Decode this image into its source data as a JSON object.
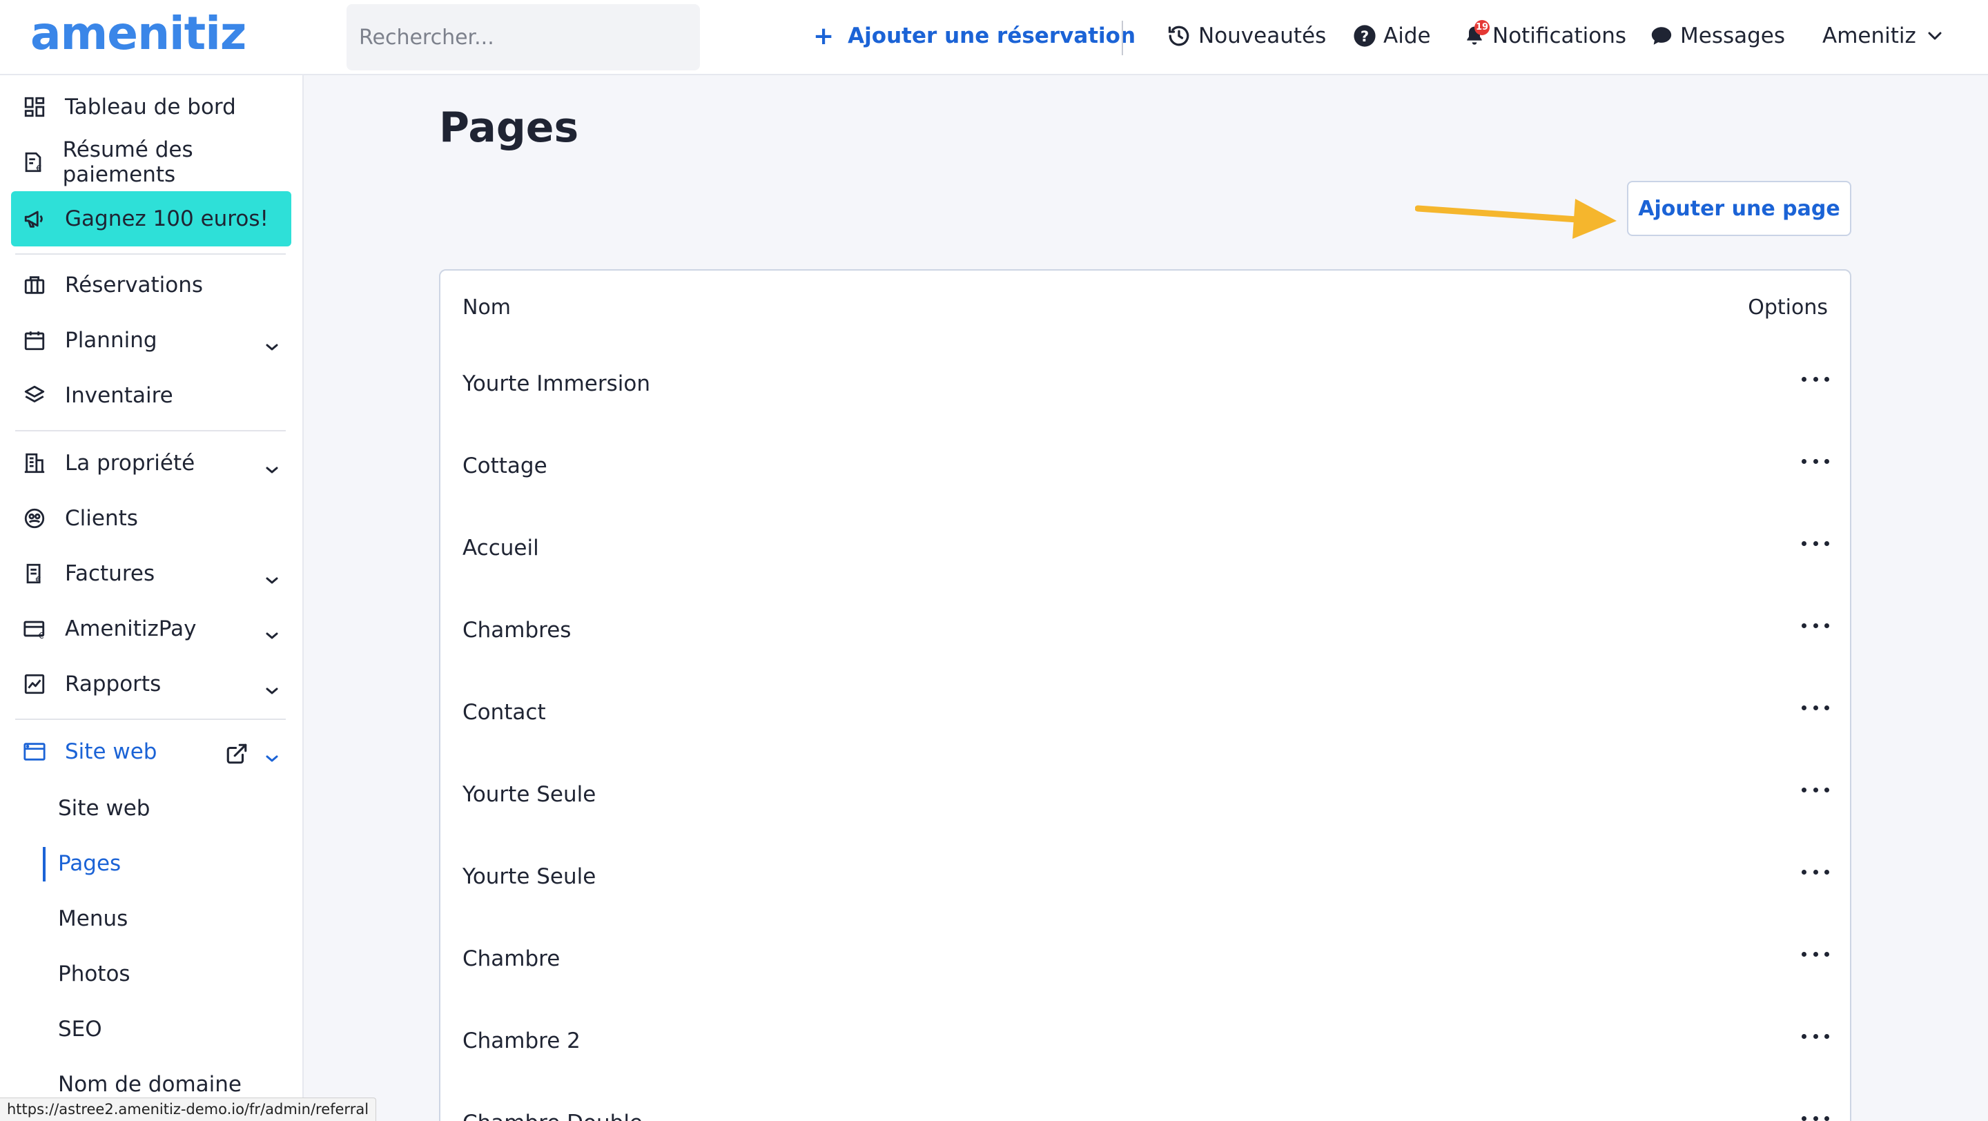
{
  "header": {
    "logo": "amenitiz",
    "search_placeholder": "Rechercher...",
    "add_reservation": "Ajouter une réservation",
    "nouveautes": "Nouveautés",
    "aide": "Aide",
    "notifications": "Notifications",
    "notification_count": "19",
    "messages": "Messages",
    "account": "Amenitiz"
  },
  "sidebar": {
    "items": [
      {
        "label": "Tableau de bord",
        "icon": "dashboard-icon"
      },
      {
        "label": "Résumé des paiements",
        "icon": "payment-summary-icon"
      },
      {
        "label": "Gagnez 100 euros!",
        "icon": "megaphone-icon"
      },
      {
        "label": "Réservations",
        "icon": "briefcase-icon"
      },
      {
        "label": "Planning",
        "icon": "calendar-icon"
      },
      {
        "label": "Inventaire",
        "icon": "layers-icon"
      },
      {
        "label": "La propriété",
        "icon": "building-icon"
      },
      {
        "label": "Clients",
        "icon": "clients-icon"
      },
      {
        "label": "Factures",
        "icon": "invoice-icon"
      },
      {
        "label": "AmenitizPay",
        "icon": "card-icon"
      },
      {
        "label": "Rapports",
        "icon": "chart-icon"
      },
      {
        "label": "Site web",
        "icon": "browser-icon"
      }
    ],
    "website_sub": [
      "Site web",
      "Pages",
      "Menus",
      "Photos",
      "SEO",
      "Nom de domaine"
    ],
    "active_sub": "Pages",
    "accent_color": "#1b63d6",
    "promo_color": "#2ee0d8"
  },
  "main": {
    "title": "Pages",
    "add_page_button": "Ajouter une page",
    "arrow_color": "#f5b62d",
    "table": {
      "col_name": "Nom",
      "col_options": "Options",
      "rows": [
        "Yourte Immersion",
        "Cottage",
        "Accueil",
        "Chambres",
        "Contact",
        "Yourte Seule",
        "Yourte Seule",
        "Chambre",
        "Chambre 2",
        "Chambre Double"
      ]
    }
  },
  "status_bar": {
    "url": "https://astree2.amenitiz-demo.io/fr/admin/referral"
  }
}
